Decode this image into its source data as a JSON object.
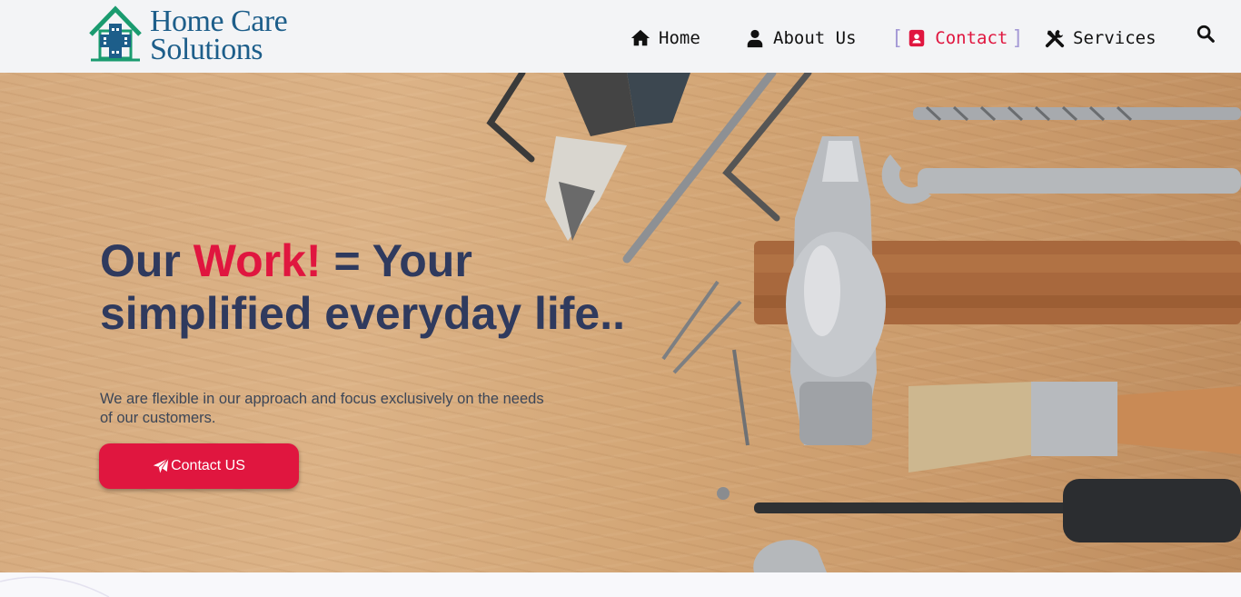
{
  "brand": {
    "line1": "Home Care",
    "line2": "Solutions"
  },
  "nav": {
    "home": "Home",
    "about": "About Us",
    "contact": "Contact",
    "services": "Services"
  },
  "hero": {
    "headline_part1": "Our ",
    "headline_accent": "Work!",
    "headline_part2": " = Your simplified everyday life..",
    "subtext": "We are flexible in our approach and focus exclusively on the needs of our customers.",
    "cta_label": "Contact US"
  },
  "colors": {
    "accent": "#e0163f",
    "headline": "#2f3a5e",
    "logo_text": "#1d5e8a",
    "logo_house": "#1a9b6f",
    "header_bg": "#f3f4f6"
  },
  "icons": {
    "home": "home-icon",
    "about": "user-icon",
    "contact": "contact-card-icon",
    "services": "tools-icon",
    "search": "search-icon",
    "cta": "paper-plane-icon"
  }
}
